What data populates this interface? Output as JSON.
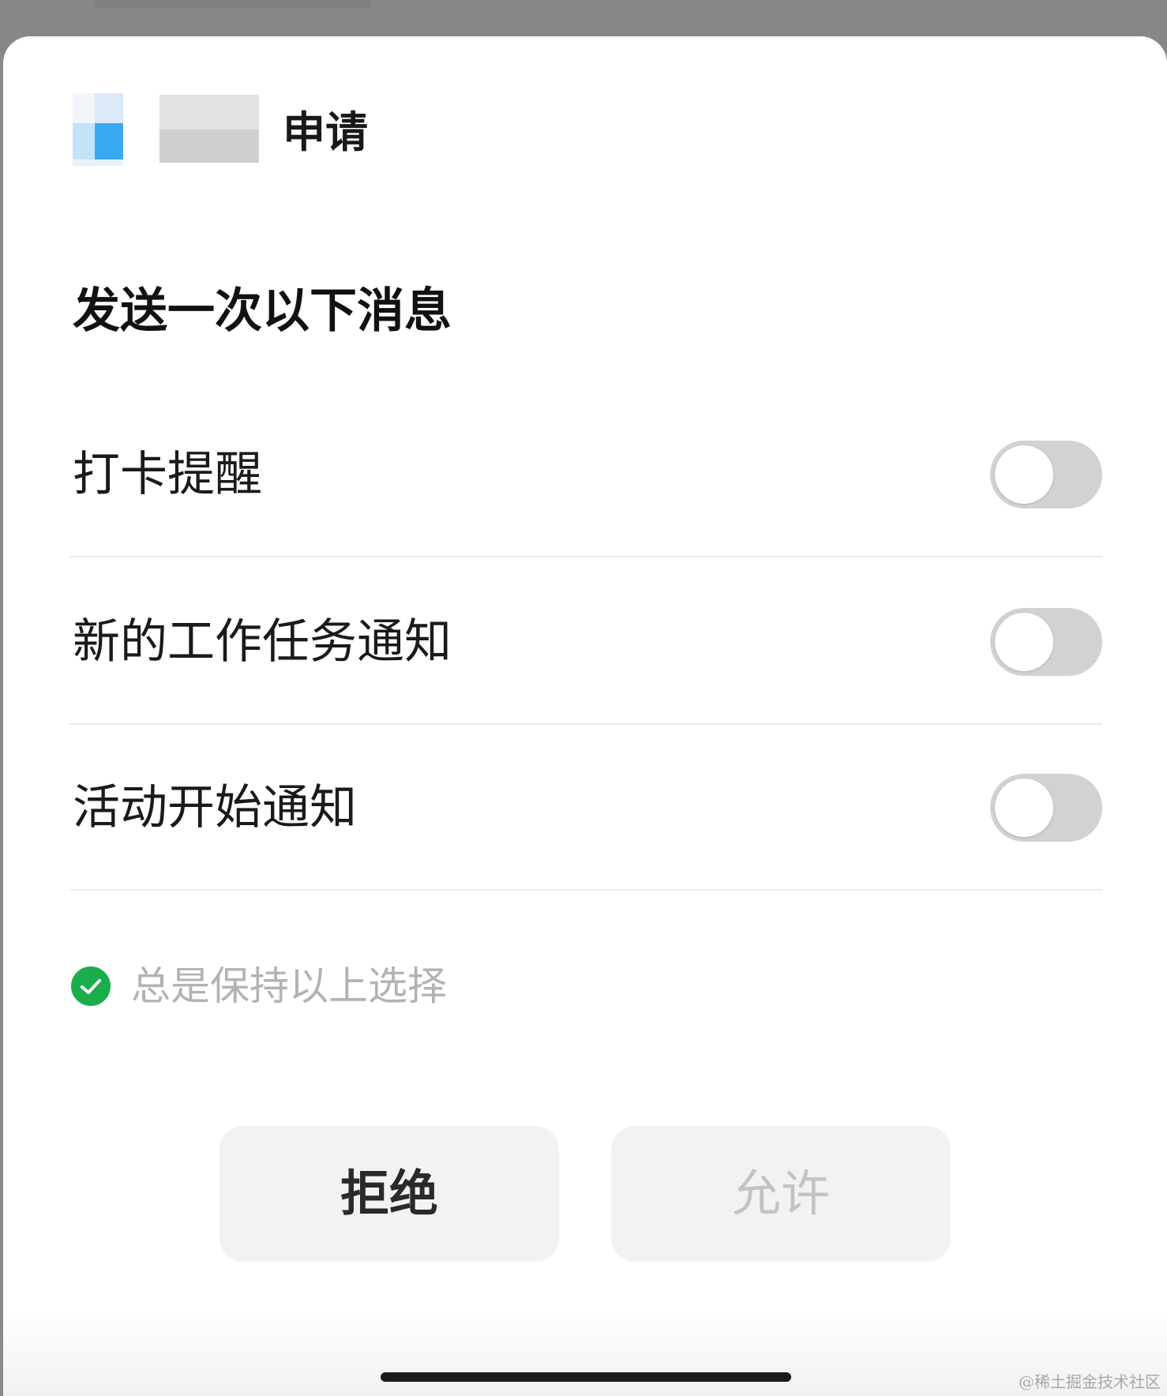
{
  "header": {
    "request_label": "申请"
  },
  "subtitle": "发送一次以下消息",
  "options": [
    {
      "label": "打卡提醒",
      "enabled": false
    },
    {
      "label": "新的工作任务通知",
      "enabled": false
    },
    {
      "label": "活动开始通知",
      "enabled": false
    }
  ],
  "keep_selection": {
    "label": "总是保持以上选择",
    "checked": true
  },
  "buttons": {
    "deny": "拒绝",
    "allow": "允许"
  },
  "watermark": "@稀土掘金技术社区",
  "colors": {
    "check_green": "#1aad4a",
    "toggle_off": "#d2d2d2",
    "logo_blue": "#3aa9f0"
  }
}
